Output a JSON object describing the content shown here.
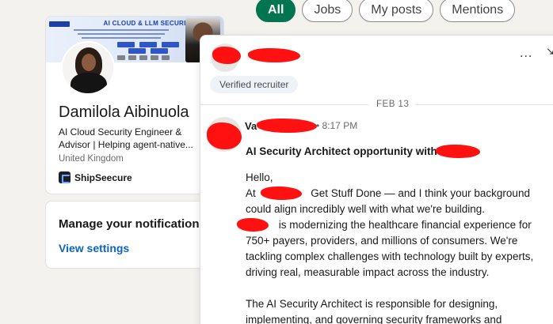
{
  "profile": {
    "banner_title": "AI CLOUD & LLM SECURITY",
    "name": "Damilola Aibinuola",
    "headline": "AI Cloud Security Engineer & Advisor | Helping agent-native...",
    "location": "United Kingdom",
    "company": "ShipSeecure"
  },
  "notifications": {
    "title": "Manage your notifications",
    "link": "View settings"
  },
  "filters": [
    {
      "label": "All",
      "active": true
    },
    {
      "label": "Jobs",
      "active": false
    },
    {
      "label": "My posts",
      "active": false
    },
    {
      "label": "Mentions",
      "active": false
    }
  ],
  "conversation": {
    "badge": "Verified recruiter",
    "date": "FEB 13",
    "more_label": "...",
    "sender_visible": "Va",
    "time": "• 8:17 PM",
    "subject": "AI Security Architect opportunity with",
    "body": {
      "greeting": "Hello,",
      "line_at": "At",
      "line_at_rest": "Get Stuff Done — and I think your background could align incredibly well with what we're building.",
      "para2": "is modernizing the healthcare financial experience for 750+ payers, providers, and millions of consumers. We're tackling complex challenges with technology built by experts, driving real, measurable impact across the industry.",
      "para3": "The AI Security Architect is responsible for designing, implementing, and governing security frameworks and"
    }
  },
  "colors": {
    "accent_green": "#01754f",
    "link_blue": "#0a66c2",
    "redaction": "#ff1111"
  },
  "icons": {
    "more": "more-icon",
    "expand": "expand-icon"
  }
}
